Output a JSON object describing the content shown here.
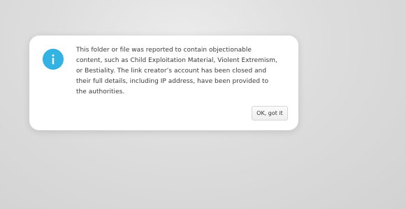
{
  "dialog": {
    "icon": "info-icon",
    "accent_color": "#33b3e3",
    "message": "This folder or file was reported to contain objectionable content, such as Child Exploitation Material, Violent Extremism, or Bestiality. The link creator’s account has been closed and their full details, including IP address, have been provided to the authorities.",
    "button_label": "OK, got it"
  }
}
